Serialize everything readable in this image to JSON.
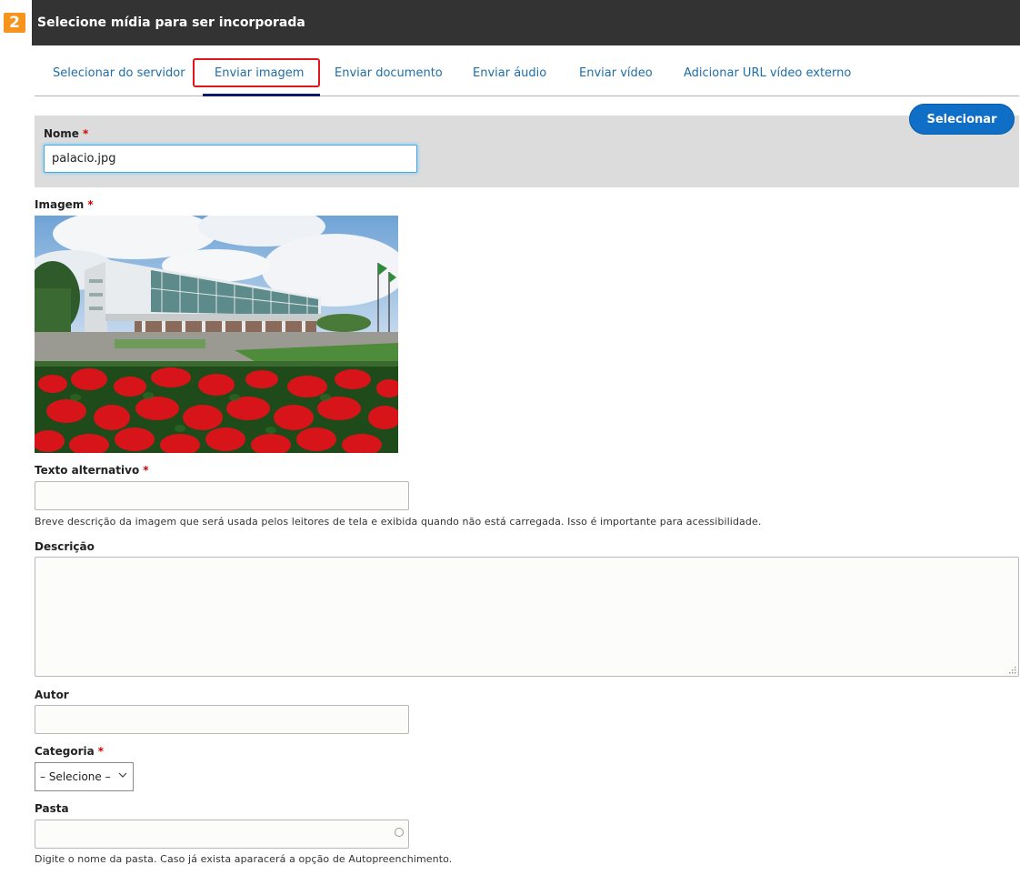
{
  "step": {
    "number": "2",
    "color": "#f7941d"
  },
  "dialog": {
    "title": "Selecione mídia para ser incorporada"
  },
  "tabs": [
    {
      "label": "Selecionar do servidor",
      "active": false
    },
    {
      "label": "Enviar imagem",
      "active": true
    },
    {
      "label": "Enviar documento",
      "active": false
    },
    {
      "label": "Enviar áudio",
      "active": false
    },
    {
      "label": "Enviar vídeo",
      "active": false
    },
    {
      "label": "Adicionar URL vídeo externo",
      "active": false
    }
  ],
  "select_button": {
    "label": "Selecionar"
  },
  "form": {
    "name": {
      "label": "Nome",
      "required_mark": "*",
      "value": "palacio.jpg"
    },
    "image": {
      "label": "Imagem",
      "required_mark": "*",
      "preview_icon": "building-photo-preview"
    },
    "alt_text": {
      "label": "Texto alternativo",
      "required_mark": "*",
      "value": "",
      "help": "Breve descrição da imagem que será usada pelos leitores de tela e exibida quando não está carregada. Isso é importante para acessibilidade."
    },
    "description": {
      "label": "Descrição",
      "value": ""
    },
    "author": {
      "label": "Autor",
      "value": ""
    },
    "category": {
      "label": "Categoria",
      "required_mark": "*",
      "selected": "– Selecione –"
    },
    "folder": {
      "label": "Pasta",
      "value": "",
      "help": "Digite o nome da pasta. Caso já exista aparacerá a opção de Autopreenchimento."
    }
  },
  "colors": {
    "titlebar": "#333333",
    "accent_blue": "#0f6fc6",
    "tab_link": "#1f6ea8",
    "highlight_red": "#e0171b",
    "required_red": "#d40000"
  }
}
